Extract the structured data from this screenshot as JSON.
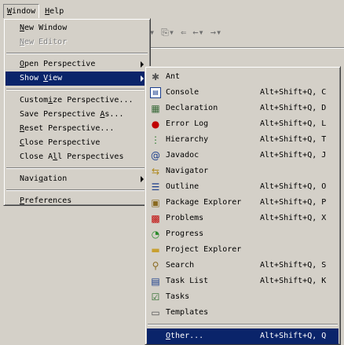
{
  "menubar": {
    "window": {
      "pre": "",
      "key": "W",
      "post": "indow"
    },
    "help": {
      "pre": "",
      "key": "H",
      "post": "elp"
    }
  },
  "toolbar": {
    "icons": [
      "new-wizard-dropdown-icon",
      "open-icon",
      "last-edit-icon",
      "back-icon",
      "forward-icon"
    ]
  },
  "window_menu": {
    "items": [
      {
        "pre": "",
        "key": "N",
        "post": "ew Window"
      },
      {
        "pre": "",
        "key": "N",
        "post": "ew Editor"
      },
      {
        "pre": "",
        "key": "O",
        "post": "pen Perspective"
      },
      {
        "pre": "Show ",
        "key": "V",
        "post": "iew"
      },
      {
        "pre": "Custom",
        "key": "i",
        "post": "ze Perspective..."
      },
      {
        "pre": "Save Perspective ",
        "key": "A",
        "post": "s..."
      },
      {
        "pre": "",
        "key": "R",
        "post": "eset Perspective..."
      },
      {
        "pre": "",
        "key": "C",
        "post": "lose Perspective"
      },
      {
        "pre": "Close A",
        "key": "l",
        "post": "l Perspectives"
      },
      {
        "pre": "Navi",
        "key": "g",
        "post": "ation"
      },
      {
        "pre": "",
        "key": "P",
        "post": "references"
      }
    ]
  },
  "show_view_menu": {
    "items": [
      {
        "label": "Ant",
        "accel": "",
        "icon": "ant-icon"
      },
      {
        "label": "Console",
        "accel": "Alt+Shift+Q, C",
        "icon": "console-icon"
      },
      {
        "label": "Declaration",
        "accel": "Alt+Shift+Q, D",
        "icon": "declaration-icon"
      },
      {
        "label": "Error Log",
        "accel": "Alt+Shift+Q, L",
        "icon": "error-log-icon"
      },
      {
        "label": "Hierarchy",
        "accel": "Alt+Shift+Q, T",
        "icon": "hierarchy-icon"
      },
      {
        "label": "Javadoc",
        "accel": "Alt+Shift+Q, J",
        "icon": "javadoc-icon"
      },
      {
        "label": "Navigator",
        "accel": "",
        "icon": "navigator-icon"
      },
      {
        "label": "Outline",
        "accel": "Alt+Shift+Q, O",
        "icon": "outline-icon"
      },
      {
        "label": "Package Explorer",
        "accel": "Alt+Shift+Q, P",
        "icon": "package-explorer-icon"
      },
      {
        "label": "Problems",
        "accel": "Alt+Shift+Q, X",
        "icon": "problems-icon"
      },
      {
        "label": "Progress",
        "accel": "",
        "icon": "progress-icon"
      },
      {
        "label": "Project Explorer",
        "accel": "",
        "icon": "project-explorer-icon"
      },
      {
        "label": "Search",
        "accel": "Alt+Shift+Q, S",
        "icon": "search-icon"
      },
      {
        "label": "Task List",
        "accel": "Alt+Shift+Q, K",
        "icon": "task-list-icon"
      },
      {
        "label": "Tasks",
        "accel": "",
        "icon": "tasks-icon"
      },
      {
        "label": "Templates",
        "accel": "",
        "icon": "templates-icon"
      },
      {
        "pre": "",
        "key": "O",
        "post": "ther...",
        "accel": "Alt+Shift+Q, Q"
      }
    ]
  },
  "colors": {
    "face": "#d4d0c8",
    "selection": "#0a246a",
    "selection_text": "#ffffff",
    "disabled_text": "#808080"
  }
}
